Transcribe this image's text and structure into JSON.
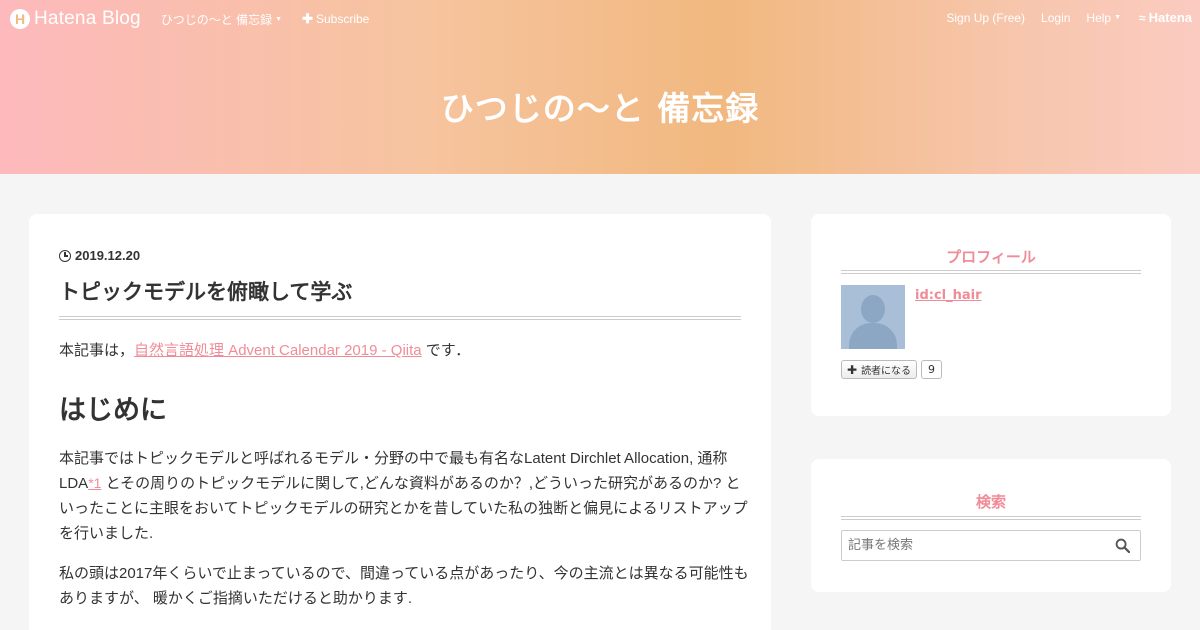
{
  "globalbar": {
    "logo_mark": "H",
    "logo_text": "Hatena Blog",
    "blog_menu": "ひつじの〜と 備忘録",
    "subscribe": "Subscribe",
    "signup": "Sign Up (Free)",
    "login": "Login",
    "help": "Help",
    "hatena": "Hatena"
  },
  "blog": {
    "title": "ひつじの〜と 備忘録"
  },
  "entry": {
    "date": "2019.12.20",
    "title": "トピックモデルを俯瞰して学ぶ",
    "intro_before": "本記事は，",
    "intro_link": "自然言語処理 Advent Calendar 2019 - Qiita",
    "intro_after": " です．",
    "heading": "はじめに",
    "p1_a": "本記事ではトピックモデルと呼ばれるモデル・分野の中で最も有名なLatent Dirchlet Allocation, 通称LDA",
    "p1_fn": "*1",
    "p1_b": " とその周りのトピックモデルに関して,どんな資料があるのか？,どういった研究があるのか? といったことに主眼をおいてトピックモデルの研究とかを昔していた私の独断と偏見によるリストアップを行いました.",
    "p2": "私の頭は2017年くらいで止まっているので、間違っている点があったり、今の主流とは異なる可能性もありますが、 暖かくご指摘いただけると助かります."
  },
  "sidebar": {
    "profile": {
      "title": "プロフィール",
      "id": "id:cl_hair",
      "subscribe_label": "読者になる",
      "subscriber_count": "9"
    },
    "search": {
      "title": "検索",
      "placeholder": "記事を検索"
    }
  },
  "colors": {
    "accent": "#f08c98",
    "header_start": "#fdb9bc",
    "header_mid": "#f1b87f"
  }
}
